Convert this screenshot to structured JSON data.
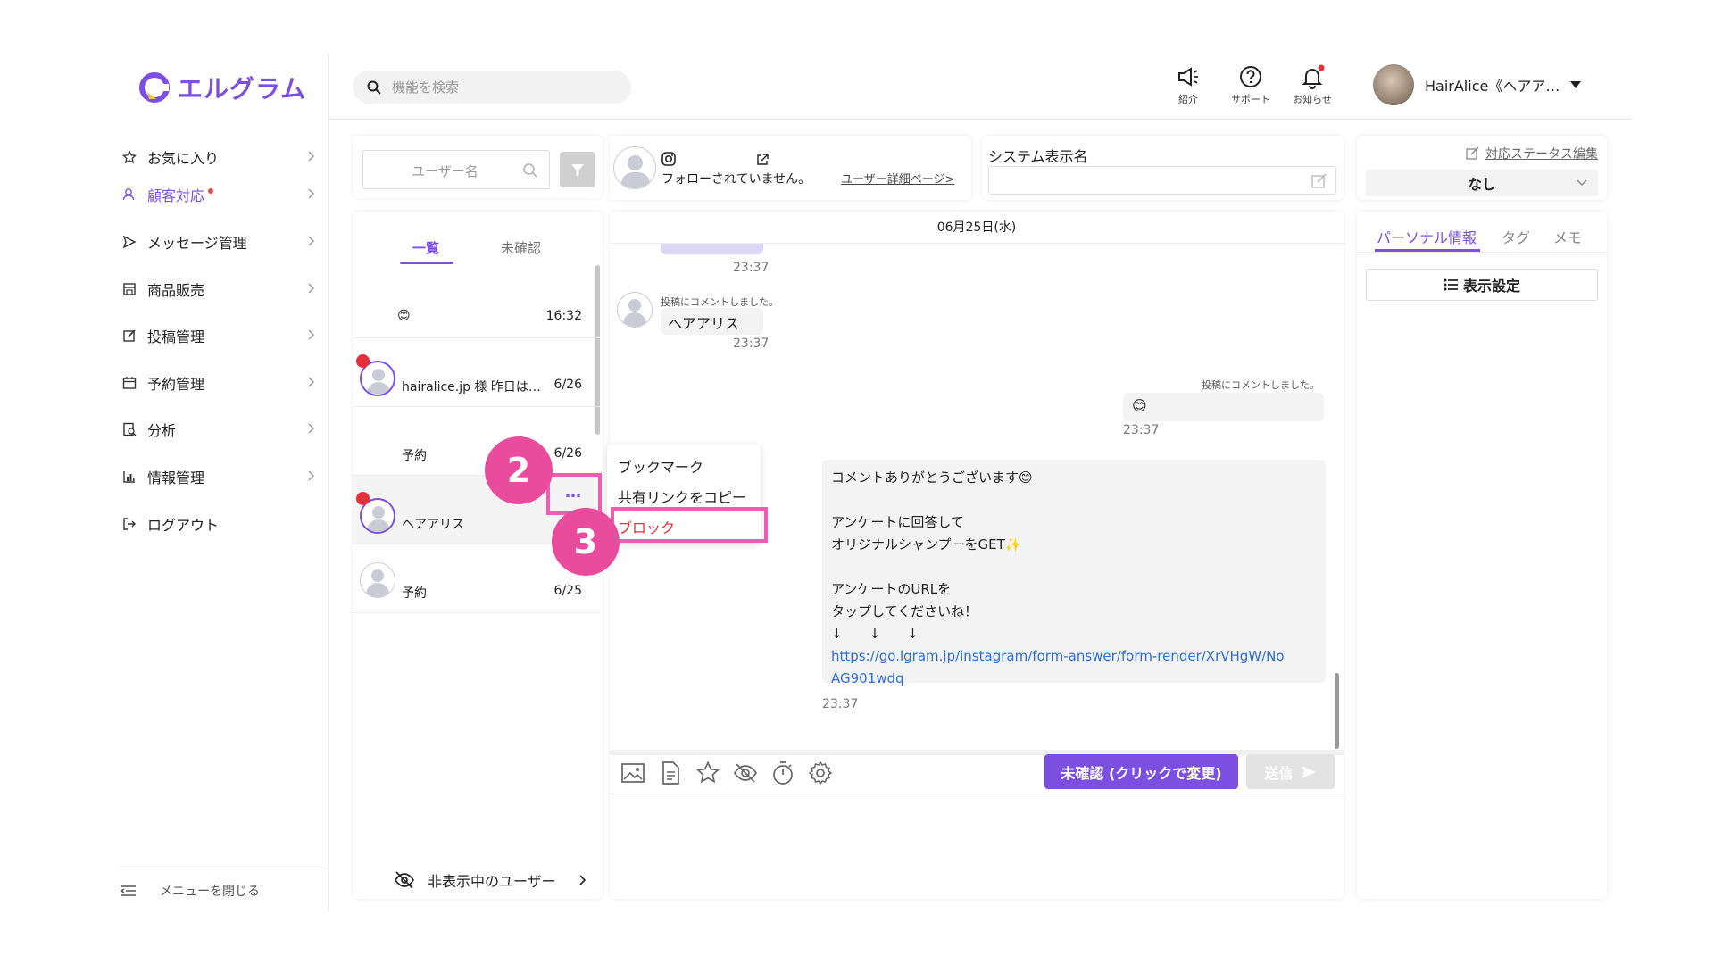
{
  "brand": {
    "name": "エルグラム",
    "accent": "#7b4fe0"
  },
  "sidebar": {
    "items": [
      {
        "label": "お気に入り",
        "icon": "star-icon"
      },
      {
        "label": "顧客対応",
        "icon": "user-icon",
        "active": true,
        "badge_dot": true
      },
      {
        "label": "メッセージ管理",
        "icon": "send-icon"
      },
      {
        "label": "商品販売",
        "icon": "shop-icon"
      },
      {
        "label": "投稿管理",
        "icon": "edit-icon"
      },
      {
        "label": "予約管理",
        "icon": "calendar-icon"
      },
      {
        "label": "分析",
        "icon": "analysis-icon"
      },
      {
        "label": "情報管理",
        "icon": "bar-chart-icon"
      },
      {
        "label": "ログアウト",
        "icon": "logout-icon"
      }
    ],
    "close_menu_label": "メニューを閉じる"
  },
  "header": {
    "search_placeholder": "機能を検索",
    "icons": [
      {
        "label": "紹介",
        "icon": "megaphone-icon"
      },
      {
        "label": "サポート",
        "icon": "help-icon"
      },
      {
        "label": "お知らせ",
        "icon": "bell-icon",
        "notification_dot": true
      }
    ],
    "profile_name": "HairAlice《ヘアア…"
  },
  "user_list": {
    "search_placeholder": "ユーザー名",
    "tabs": [
      {
        "label": "一覧",
        "active": true
      },
      {
        "label": "未確認"
      }
    ],
    "rows": [
      {
        "name": "😊",
        "date": "16:32",
        "unread": false
      },
      {
        "name": "hairalice.jp 様 昨日は…",
        "date": "6/26",
        "unread": true
      },
      {
        "name": "予約",
        "date": "6/26",
        "unread": false
      },
      {
        "name": "ヘアアリス",
        "date": "6",
        "unread": true
      },
      {
        "name": "予約",
        "date": "6/25",
        "unread": false
      }
    ],
    "hidden_users_label": "非表示中のユーザー",
    "more_button_label": "…"
  },
  "chat_header": {
    "follow_status": "フォローされていません。",
    "user_detail_link": "ユーザー詳細ページ>"
  },
  "system_name": {
    "label": "システム表示名",
    "value": ""
  },
  "status_panel": {
    "edit_link": "対応ステータス編集",
    "selected": "なし"
  },
  "chat": {
    "date_label": "06月25日(水)",
    "messages": [
      {
        "side": "left",
        "time": "23:37"
      },
      {
        "side": "left",
        "note": "投稿にコメントしました。",
        "text": "ヘアアリス",
        "time": "23:37"
      },
      {
        "side": "right",
        "note": "投稿にコメントしました。",
        "text": "😊",
        "time": "23:37"
      },
      {
        "side": "right",
        "lines": [
          "コメントありがとうございます😊",
          "",
          "アンケートに回答して",
          "オリジナルシャンプーをGET✨",
          "",
          "アンケートのURLを",
          "タップしてくださいね！",
          "↓　　↓　　↓"
        ],
        "link": "https://go.lgram.jp/instagram/form-answer/form-render/XrVHgW/No",
        "link2": "AG901wdq",
        "time": "23:37"
      }
    ]
  },
  "context_menu": {
    "items": [
      "ブックマーク",
      "共有リンクをコピー",
      "ブロック"
    ]
  },
  "steps": [
    "2",
    "3"
  ],
  "composer": {
    "toolbar_icons": [
      "image-icon",
      "document-icon",
      "star-icon",
      "hide-icon",
      "timer-icon",
      "gear-icon"
    ],
    "status_button": "未確認 (クリックで変更)",
    "send_button": "送信"
  },
  "right_panel": {
    "tabs": [
      {
        "label": "パーソナル情報",
        "active": true
      },
      {
        "label": "タグ"
      },
      {
        "label": "メモ"
      }
    ],
    "display_settings": "表示設定"
  }
}
